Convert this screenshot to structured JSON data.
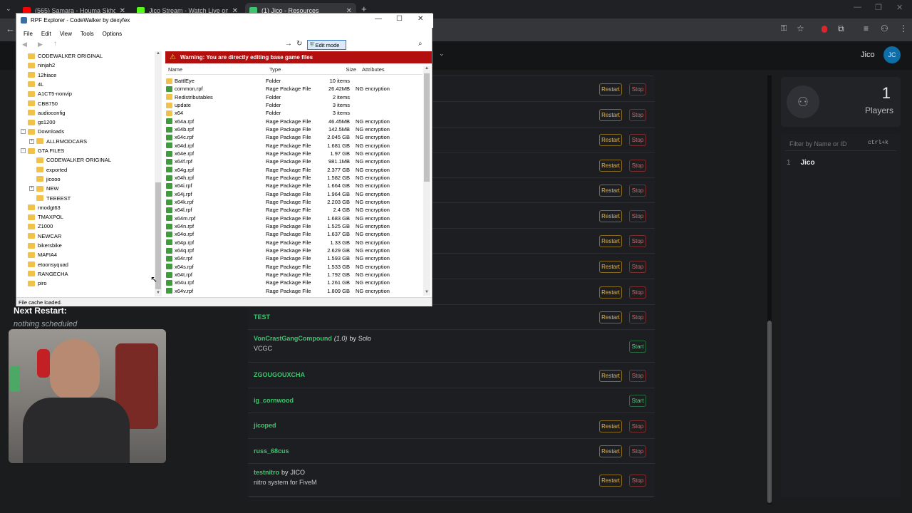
{
  "browser": {
    "tabs": [
      {
        "label": "(565) Samara - Houma Skhoun",
        "color": "#ff0000"
      },
      {
        "label": "Jico Stream - Watch Live on Ki",
        "color": "#53fc18"
      },
      {
        "label": "(1) Jico - Resources",
        "color": "#3ec46d"
      }
    ]
  },
  "webpage": {
    "nav_user": "Jico",
    "next_restart_label": "Next Restart:",
    "next_restart_value": "nothing scheduled",
    "players_count": "1",
    "players_label": "Players",
    "filter_placeholder": "Filter by Name or ID",
    "filter_shortcut": "ctrl+k",
    "player_list": [
      {
        "id": "1",
        "name": "Jico"
      }
    ],
    "restart_label": "Restart",
    "stop_label": "Stop",
    "start_label": "Start",
    "resources": [
      {
        "name": "",
        "version": "",
        "author": "",
        "desc": "",
        "running": true
      },
      {
        "name": "",
        "version": "",
        "author": "",
        "desc": "",
        "running": true
      },
      {
        "name": "",
        "version": "",
        "author": "",
        "desc": "",
        "running": true
      },
      {
        "name": "",
        "version": "",
        "author": "",
        "desc": "",
        "running": true
      },
      {
        "name": "",
        "version": "",
        "author": "",
        "desc": "",
        "running": true
      },
      {
        "name": "",
        "version": "",
        "author": "",
        "desc": "",
        "running": true
      },
      {
        "name": "",
        "version": "",
        "author": "",
        "desc": "",
        "running": true
      },
      {
        "name": "",
        "version": "",
        "author": "",
        "desc": "",
        "running": true
      },
      {
        "name": "",
        "version": "",
        "author": "",
        "desc": "",
        "running": true
      },
      {
        "name": "TEST",
        "version": "",
        "author": "",
        "desc": "",
        "running": true
      },
      {
        "name": "VonCrastGangCompound",
        "version": "(1.0)",
        "author": "Solo",
        "desc": "VCGC",
        "running": false
      },
      {
        "name": "ZGOUGOUXCHA",
        "version": "",
        "author": "",
        "desc": "",
        "running": true
      },
      {
        "name": "ig_cornwood",
        "version": "",
        "author": "",
        "desc": "",
        "running": false
      },
      {
        "name": "jicoped",
        "version": "",
        "author": "",
        "desc": "",
        "running": true
      },
      {
        "name": "russ_68cus",
        "version": "",
        "author": "",
        "desc": "",
        "running": true
      },
      {
        "name": "testnitro",
        "version": "",
        "author": "JICO",
        "desc": "nitro system for FiveM",
        "running": true
      }
    ],
    "by_word": "by"
  },
  "explorer": {
    "title": "RPF Explorer - CodeWalker by dexyfex",
    "menu": [
      "File",
      "Edit",
      "View",
      "Tools",
      "Options"
    ],
    "edit_mode_label": "Edit mode",
    "warning": "Warning: You are directly editing base game files",
    "status": "File cache loaded.",
    "columns": {
      "name": "Name",
      "type": "Type",
      "size": "Size",
      "attributes": "Attributes"
    },
    "tree": [
      {
        "label": "CODEWALKER ORIGINAL",
        "level": 1,
        "expander": ""
      },
      {
        "label": "ninjah2",
        "level": 1,
        "expander": ""
      },
      {
        "label": "12hiace",
        "level": 1,
        "expander": ""
      },
      {
        "label": "4L",
        "level": 1,
        "expander": ""
      },
      {
        "label": "A1CT5-nonvip",
        "level": 1,
        "expander": ""
      },
      {
        "label": "CBB750",
        "level": 1,
        "expander": ""
      },
      {
        "label": "audioconfig",
        "level": 1,
        "expander": ""
      },
      {
        "label": "gs1200",
        "level": 1,
        "expander": ""
      },
      {
        "label": "Downloads",
        "level": 1,
        "expander": "-"
      },
      {
        "label": "ALLRMODCARS",
        "level": 2,
        "expander": "+"
      },
      {
        "label": "GTA FILES",
        "level": 1,
        "expander": "-"
      },
      {
        "label": "CODEWALKER ORIGINAL",
        "level": 2,
        "expander": ""
      },
      {
        "label": "exported",
        "level": 2,
        "expander": ""
      },
      {
        "label": "jicooo",
        "level": 2,
        "expander": ""
      },
      {
        "label": "NEW",
        "level": 2,
        "expander": "+"
      },
      {
        "label": "TEEEEST",
        "level": 2,
        "expander": ""
      },
      {
        "label": "rmodgt63",
        "level": 1,
        "expander": ""
      },
      {
        "label": "TMAXPOL",
        "level": 1,
        "expander": ""
      },
      {
        "label": "Z1000",
        "level": 1,
        "expander": ""
      },
      {
        "label": "NEWCAR",
        "level": 1,
        "expander": ""
      },
      {
        "label": "bikersbike",
        "level": 1,
        "expander": ""
      },
      {
        "label": "MAFIA4",
        "level": 1,
        "expander": ""
      },
      {
        "label": "etoonsyquad",
        "level": 1,
        "expander": ""
      },
      {
        "label": "RANGECHA",
        "level": 1,
        "expander": ""
      },
      {
        "label": "piro",
        "level": 1,
        "expander": ""
      }
    ],
    "files": [
      {
        "name": "BattlEye",
        "type": "Folder",
        "size": "10 items",
        "attr": "",
        "kind": "folder"
      },
      {
        "name": "common.rpf",
        "type": "Rage Package File",
        "size": "26.42MB",
        "attr": "NG encryption",
        "kind": "rpf"
      },
      {
        "name": "Redistributables",
        "type": "Folder",
        "size": "2 items",
        "attr": "",
        "kind": "folder"
      },
      {
        "name": "update",
        "type": "Folder",
        "size": "3 items",
        "attr": "",
        "kind": "folder"
      },
      {
        "name": "x64",
        "type": "Folder",
        "size": "3 items",
        "attr": "",
        "kind": "folder"
      },
      {
        "name": "x64a.rpf",
        "type": "Rage Package File",
        "size": "46.45MB",
        "attr": "NG encryption",
        "kind": "rpf"
      },
      {
        "name": "x64b.rpf",
        "type": "Rage Package File",
        "size": "142.5MB",
        "attr": "NG encryption",
        "kind": "rpf"
      },
      {
        "name": "x64c.rpf",
        "type": "Rage Package File",
        "size": "2.045 GB",
        "attr": "NG encryption",
        "kind": "rpf"
      },
      {
        "name": "x64d.rpf",
        "type": "Rage Package File",
        "size": "1.681 GB",
        "attr": "NG encryption",
        "kind": "rpf"
      },
      {
        "name": "x64e.rpf",
        "type": "Rage Package File",
        "size": "1.97 GB",
        "attr": "NG encryption",
        "kind": "rpf"
      },
      {
        "name": "x64f.rpf",
        "type": "Rage Package File",
        "size": "981.1MB",
        "attr": "NG encryption",
        "kind": "rpf"
      },
      {
        "name": "x64g.rpf",
        "type": "Rage Package File",
        "size": "2.377 GB",
        "attr": "NG encryption",
        "kind": "rpf"
      },
      {
        "name": "x64h.rpf",
        "type": "Rage Package File",
        "size": "1.582 GB",
        "attr": "NG encryption",
        "kind": "rpf"
      },
      {
        "name": "x64i.rpf",
        "type": "Rage Package File",
        "size": "1.664 GB",
        "attr": "NG encryption",
        "kind": "rpf"
      },
      {
        "name": "x64j.rpf",
        "type": "Rage Package File",
        "size": "1.964 GB",
        "attr": "NG encryption",
        "kind": "rpf"
      },
      {
        "name": "x64k.rpf",
        "type": "Rage Package File",
        "size": "2.203 GB",
        "attr": "NG encryption",
        "kind": "rpf"
      },
      {
        "name": "x64l.rpf",
        "type": "Rage Package File",
        "size": "2.4 GB",
        "attr": "NG encryption",
        "kind": "rpf"
      },
      {
        "name": "x64m.rpf",
        "type": "Rage Package File",
        "size": "1.683 GB",
        "attr": "NG encryption",
        "kind": "rpf"
      },
      {
        "name": "x64n.rpf",
        "type": "Rage Package File",
        "size": "1.525 GB",
        "attr": "NG encryption",
        "kind": "rpf"
      },
      {
        "name": "x64o.rpf",
        "type": "Rage Package File",
        "size": "1.637 GB",
        "attr": "NG encryption",
        "kind": "rpf"
      },
      {
        "name": "x64p.rpf",
        "type": "Rage Package File",
        "size": "1.33 GB",
        "attr": "NG encryption",
        "kind": "rpf"
      },
      {
        "name": "x64q.rpf",
        "type": "Rage Package File",
        "size": "2.629 GB",
        "attr": "NG encryption",
        "kind": "rpf"
      },
      {
        "name": "x64r.rpf",
        "type": "Rage Package File",
        "size": "1.593 GB",
        "attr": "NG encryption",
        "kind": "rpf"
      },
      {
        "name": "x64s.rpf",
        "type": "Rage Package File",
        "size": "1.533 GB",
        "attr": "NG encryption",
        "kind": "rpf"
      },
      {
        "name": "x64t.rpf",
        "type": "Rage Package File",
        "size": "1.792 GB",
        "attr": "NG encryption",
        "kind": "rpf"
      },
      {
        "name": "x64u.rpf",
        "type": "Rage Package File",
        "size": "1.261 GB",
        "attr": "NG encryption",
        "kind": "rpf"
      },
      {
        "name": "x64v.rpf",
        "type": "Rage Package File",
        "size": "1.809 GB",
        "attr": "NG encryption",
        "kind": "rpf"
      }
    ]
  }
}
